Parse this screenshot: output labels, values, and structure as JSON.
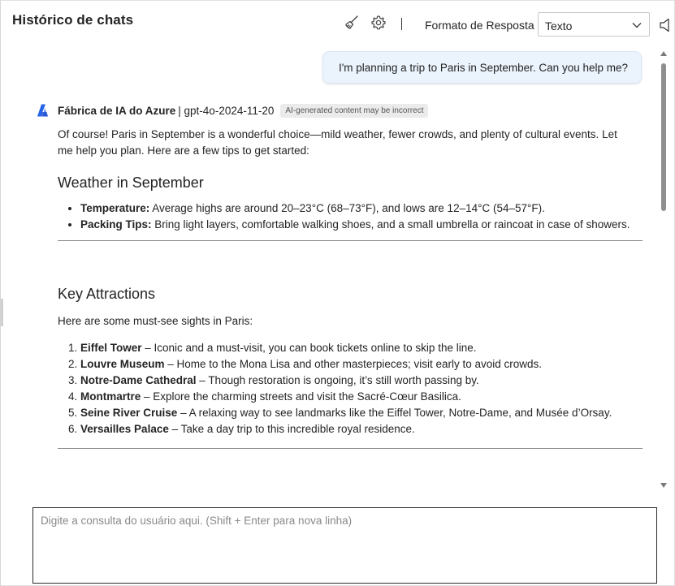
{
  "header": {
    "title": "Histórico de chats",
    "clear_icon": "broom-icon",
    "settings_icon": "gear-icon",
    "separator": "|",
    "format_label": "Formato de Resposta",
    "format_value": "Texto",
    "speaker_icon": "speaker-icon"
  },
  "chat": {
    "user_message": "I'm planning a trip to Paris in September. Can you help me?",
    "bot": {
      "name": "Fábrica de IA do Azure",
      "model": "| gpt-4o-2024-11-20",
      "badge": "AI-generated content may be incorrect",
      "intro_line1": "Of course! Paris in September is a wonderful choice—mild weather, fewer crowds, and plenty of cultural events. Let",
      "intro_line2": "me help you plan. Here are a few tips to get started:",
      "weather": {
        "heading": "Weather in September",
        "items": [
          {
            "bold": "Temperature:",
            "text": " Average highs are around 20–23°C (68–73°F), and lows are 12–14°C (54–57°F)."
          },
          {
            "bold": "Packing Tips:",
            "text": " Bring light layers, comfortable walking shoes, and a small umbrella or raincoat in case of showers."
          }
        ]
      },
      "attractions": {
        "heading": "Key Attractions",
        "intro": "Here are some must-see sights in Paris:",
        "items": [
          {
            "bold": "Eiffel Tower",
            "text": " – Iconic and a must-visit, you can book tickets online to skip the line."
          },
          {
            "bold": "Louvre Museum",
            "text": " – Home to the Mona Lisa and other masterpieces; visit early to avoid crowds."
          },
          {
            "bold": "Notre-Dame Cathedral",
            "text": " – Though restoration is ongoing, it’s still worth passing by."
          },
          {
            "bold": "Montmartre",
            "text": " – Explore the charming streets and visit the Sacré-Cœur Basilica."
          },
          {
            "bold": "Seine River Cruise",
            "text": " – A relaxing way to see landmarks like the Eiffel Tower, Notre-Dame, and Musée d’Orsay."
          },
          {
            "bold": "Versailles Palace",
            "text": " – Take a day trip to this incredible royal residence."
          }
        ]
      }
    }
  },
  "input": {
    "placeholder": "Digite a consulta do usuário aqui. (Shift + Enter para nova linha)",
    "value": ""
  },
  "colors": {
    "user_bubble_bg": "#ebf3fc",
    "accent_blue": "#2563eb"
  }
}
